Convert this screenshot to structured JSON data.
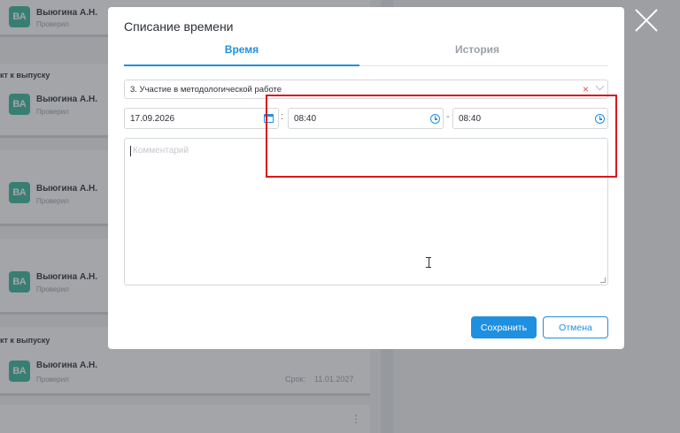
{
  "background": {
    "cards": [
      {
        "initials": "ВА",
        "name": "Выюгина А.Н.",
        "role": "Проверил"
      },
      {
        "initials": "ВА",
        "name": "Выюгина А.Н.",
        "role": "Проверил"
      },
      {
        "initials": "ВА",
        "name": "Выюгина А.Н.",
        "role": "Проверил"
      },
      {
        "initials": "ВА",
        "name": "Выюгина А.Н.",
        "role": "Проверил"
      },
      {
        "initials": "ВА",
        "name": "Выюгина А.Н.",
        "role": "Проверил"
      }
    ],
    "section_titles": [
      "кт к выпуску",
      "кт к выпуску"
    ],
    "deadline_label": "Срок:",
    "deadline_value": "11.01.2027"
  },
  "modal": {
    "title": "Списание времени",
    "tabs": [
      {
        "label": "Время",
        "active": true
      },
      {
        "label": "История",
        "active": false
      }
    ],
    "activity_select": {
      "value": "3. Участие в методологической работе"
    },
    "date": "17.09.2026",
    "time_start": "08:40",
    "time_end": "08:40",
    "separator_colon": ":",
    "separator_dash": "-",
    "comment_placeholder": "Комментарий",
    "save_label": "Сохранить",
    "cancel_label": "Отмена"
  },
  "colors": {
    "accent": "#1f8fe0",
    "avatar": "#35b59c",
    "highlight": "#d9161d",
    "clear": "#e0534a"
  },
  "icons": [
    "close-icon",
    "clear-icon",
    "chevron-down-icon",
    "calendar-icon",
    "clock-icon",
    "text-cursor-icon"
  ]
}
